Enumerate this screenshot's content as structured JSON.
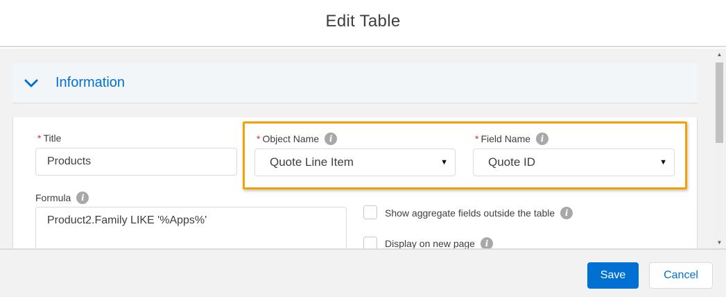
{
  "modal": {
    "title": "Edit Table"
  },
  "section": {
    "title": "Information",
    "expanded": true
  },
  "fields": {
    "title": {
      "required_mark": "*",
      "label": "Title",
      "value": "Products"
    },
    "object_name": {
      "required_mark": "*",
      "label": "Object Name",
      "value": "Quote Line Item"
    },
    "field_name": {
      "required_mark": "*",
      "label": "Field Name",
      "value": "Quote ID"
    },
    "formula": {
      "label": "Formula",
      "value": "Product2.Family LIKE '%Apps%'"
    },
    "show_aggregate": {
      "label": "Show aggregate fields outside the table",
      "checked": false
    },
    "display_new_page": {
      "label": "Display on new page",
      "checked": false
    }
  },
  "footer": {
    "save_label": "Save",
    "cancel_label": "Cancel"
  },
  "colors": {
    "brand": "#0070d2",
    "highlight": "#f5a100",
    "required": "#c23934"
  }
}
